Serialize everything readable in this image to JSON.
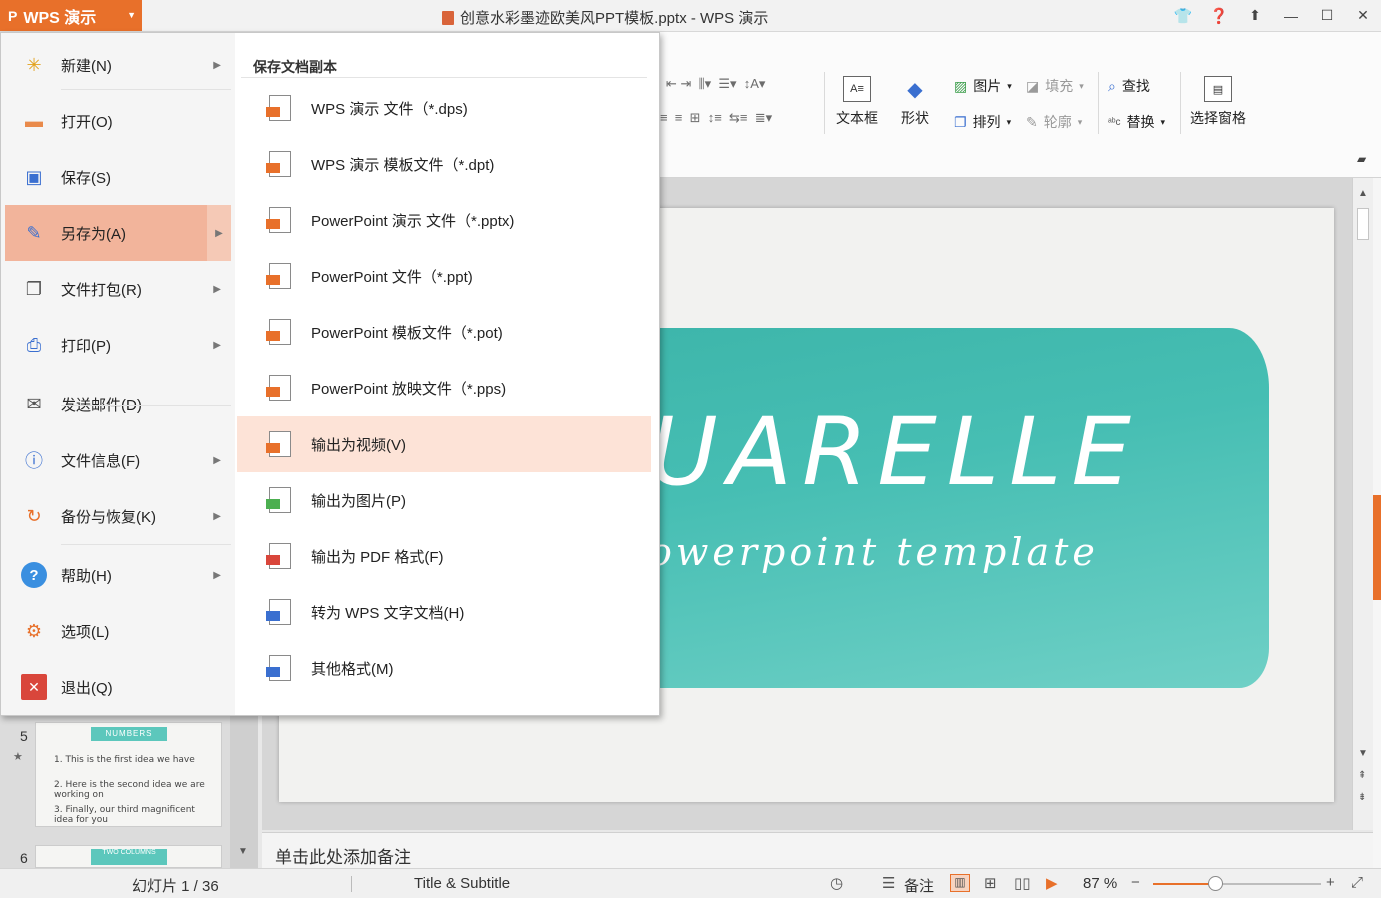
{
  "titlebar": {
    "app_name": "WPS 演示",
    "app_logo": "P",
    "document_title": "创意水彩墨迹欧美风PPT模板.pptx - WPS 演示"
  },
  "ribbon": {
    "textbox_label": "文本框",
    "shape_label": "形状",
    "picture_label": "图片",
    "arrange_label": "排列",
    "fill_label": "填充",
    "outline_label": "轮廓",
    "find_label": "查找",
    "replace_label": "替换",
    "selection_pane_label": "选择窗格"
  },
  "file_menu": {
    "items": [
      {
        "label": "新建(N)",
        "icon": "new-file-icon",
        "has_submenu": true
      },
      {
        "label": "打开(O)",
        "icon": "open-folder-icon",
        "has_submenu": false
      },
      {
        "label": "保存(S)",
        "icon": "save-disk-icon",
        "has_submenu": false
      },
      {
        "label": "另存为(A)",
        "icon": "save-as-icon",
        "has_submenu": true
      },
      {
        "label": "文件打包(R)",
        "icon": "package-icon",
        "has_submenu": true
      },
      {
        "label": "打印(P)",
        "icon": "printer-icon",
        "has_submenu": true
      },
      {
        "label": "发送邮件(D)",
        "icon": "mail-icon",
        "has_submenu": false
      },
      {
        "label": "文件信息(F)",
        "icon": "file-info-icon",
        "has_submenu": true
      },
      {
        "label": "备份与恢复(K)",
        "icon": "backup-icon",
        "has_submenu": true
      },
      {
        "label": "帮助(H)",
        "icon": "help-icon",
        "has_submenu": true
      },
      {
        "label": "选项(L)",
        "icon": "gear-icon",
        "has_submenu": false
      },
      {
        "label": "退出(Q)",
        "icon": "exit-icon",
        "has_submenu": false
      }
    ],
    "selected": "另存为(A)"
  },
  "save_as_submenu": {
    "heading": "保存文档副本",
    "items": [
      {
        "label": "WPS 演示 文件（*.dps)",
        "icon": "dps-file-icon"
      },
      {
        "label": "WPS 演示 模板文件（*.dpt)",
        "icon": "dpt-file-icon"
      },
      {
        "label": "PowerPoint 演示 文件（*.pptx)",
        "icon": "pptx-file-icon"
      },
      {
        "label": "PowerPoint 文件（*.ppt)",
        "icon": "ppt-file-icon"
      },
      {
        "label": "PowerPoint 模板文件（*.pot)",
        "icon": "pot-file-icon"
      },
      {
        "label": "PowerPoint 放映文件（*.pps)",
        "icon": "pps-file-icon"
      },
      {
        "label": "输出为视频(V)",
        "icon": "video-export-icon"
      },
      {
        "label": "输出为图片(P)",
        "icon": "image-export-icon"
      },
      {
        "label": "输出为 PDF 格式(F)",
        "icon": "pdf-export-icon"
      },
      {
        "label": "转为 WPS 文字文档(H)",
        "icon": "convert-doc-icon"
      },
      {
        "label": "其他格式(M)",
        "icon": "other-format-icon"
      }
    ],
    "hovered": "输出为视频(V)"
  },
  "slide": {
    "title": "UARELLE",
    "subtitle": "owerpoint template"
  },
  "thumbnails": {
    "slide5_number": "5",
    "slide5_tag": "NUMBERS",
    "slide5_lines": [
      "1.  This is the first idea we have",
      "2.  Here is the second idea we are working on",
      "3.  Finally, our third magnificent idea for you"
    ],
    "slide6_number": "6",
    "slide6_tag": "TWO COLUMNS"
  },
  "notes": {
    "placeholder": "单击此处添加备注"
  },
  "statusbar": {
    "slide_counter": "幻灯片 1 / 36",
    "layout_name": "Title & Subtitle",
    "notes_label": "备注",
    "zoom": "87 %",
    "zoom_fraction": 0.37
  },
  "colors": {
    "accent": "#e8702a",
    "menu_selected": "#f2b49b",
    "submenu_hover": "#fde3d7",
    "watercolor": "#46beb3"
  }
}
